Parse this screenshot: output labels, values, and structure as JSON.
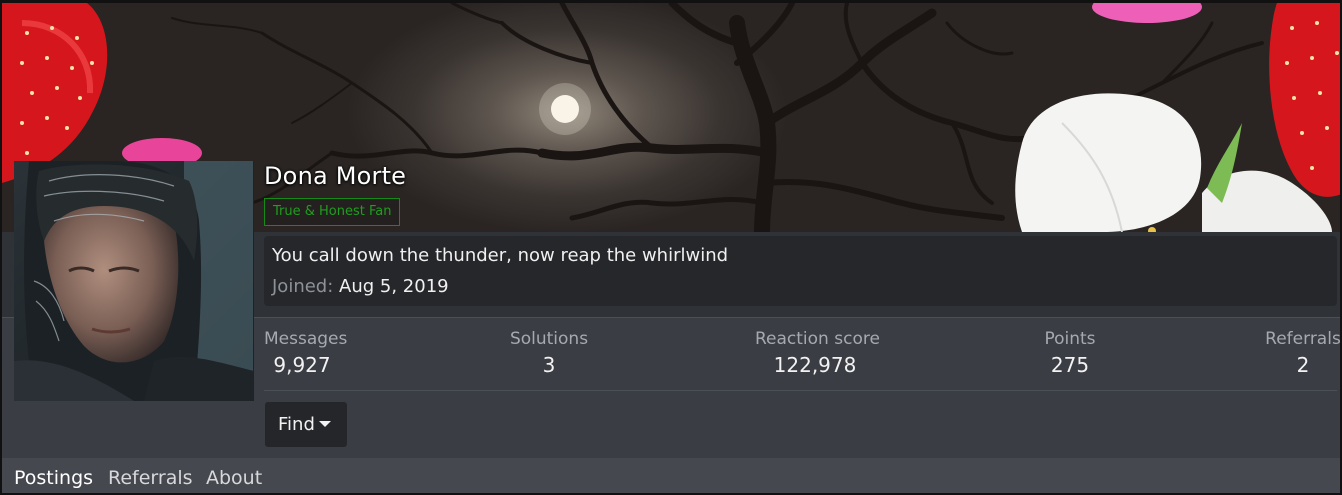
{
  "profile": {
    "username": "Dona Morte",
    "user_title": "True & Honest Fan",
    "about": "You call down the thunder, now reap the whirlwind",
    "joined_label": "Joined:",
    "joined_value": "Aug 5, 2019"
  },
  "stats": [
    {
      "label": "Messages",
      "value": "9,927"
    },
    {
      "label": "Solutions",
      "value": "3"
    },
    {
      "label": "Reaction score",
      "value": "122,978"
    },
    {
      "label": "Points",
      "value": "275"
    },
    {
      "label": "Referrals",
      "value": "2"
    }
  ],
  "actions": {
    "find_label": "Find"
  },
  "tabs": [
    {
      "label": "Postings",
      "active": true
    },
    {
      "label": "Referrals",
      "active": false
    },
    {
      "label": "About",
      "active": false
    }
  ],
  "colors": {
    "badge_green": "#1f9e1f",
    "background": "#3a3d43",
    "panel": "#25272b"
  }
}
